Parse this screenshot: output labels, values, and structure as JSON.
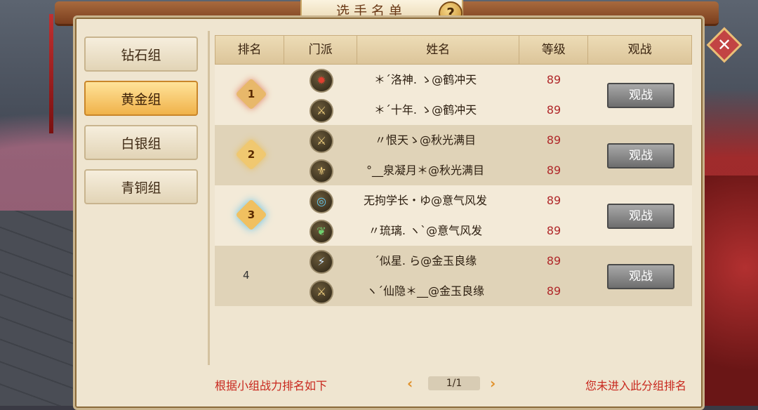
{
  "title": "选手名单",
  "help_icon": "?",
  "close_icon": "✕",
  "tabs": [
    "钻石组",
    "黄金组",
    "白银组",
    "青铜组"
  ],
  "active_tab": "黄金组",
  "columns": [
    "排名",
    "门派",
    "姓名",
    "等级",
    "观战"
  ],
  "groups": [
    {
      "rank": "1",
      "watch_label": "观战",
      "players": [
        {
          "name": "＊ˊ洛神. ゝ@鹤冲天",
          "level": "89",
          "sect_icon": "flame-icon"
        },
        {
          "name": "＊ˊ十年. ゝ@鹤冲天",
          "level": "89",
          "sect_icon": "sword-icon"
        }
      ]
    },
    {
      "rank": "2",
      "watch_label": "观战",
      "players": [
        {
          "name": "〃恨天ゝ@秋光满目",
          "level": "89",
          "sect_icon": "sword-icon"
        },
        {
          "name": "°__泉凝月＊@秋光满目",
          "level": "89",
          "sect_icon": "fleur-icon"
        }
      ]
    },
    {
      "rank": "3",
      "watch_label": "观战",
      "players": [
        {
          "name": "无拘学长・ゆ@意气风发",
          "level": "89",
          "sect_icon": "ring-icon"
        },
        {
          "name": "〃琉璃. ヽ`@意气风发",
          "level": "89",
          "sect_icon": "butterfly-icon"
        }
      ]
    },
    {
      "rank": "4",
      "watch_label": "观战",
      "players": [
        {
          "name": "ˊ似星. ら@金玉良缘",
          "level": "89",
          "sect_icon": "blade-icon"
        },
        {
          "name": "ヽˊ仙隐＊__@金玉良缘",
          "level": "89",
          "sect_icon": "sword-icon"
        }
      ]
    }
  ],
  "footer_left": "根据小组战力排名如下",
  "footer_right": "您未进入此分组排名",
  "pagination": {
    "text": "1/1",
    "prev": "‹",
    "next": "›"
  },
  "colors": {
    "accent": "#c8281e",
    "level": "#b0282a",
    "active_tab": "#f0b24a"
  }
}
